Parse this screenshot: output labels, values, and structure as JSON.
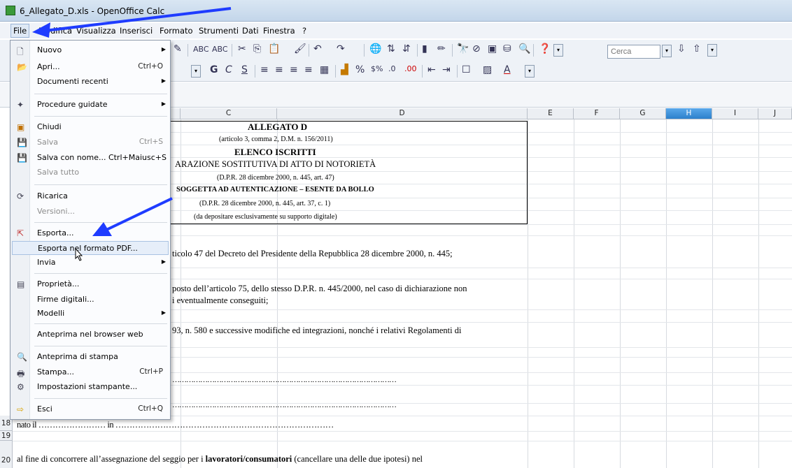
{
  "window": {
    "title": "6_Allegato_D.xls - OpenOffice Calc"
  },
  "menubar": [
    "File",
    "Modifica",
    "Visualizza",
    "Inserisci",
    "Formato",
    "Strumenti",
    "Dati",
    "Finestra",
    "?"
  ],
  "toolbar": {
    "find_placeholder": "Cerca"
  },
  "columns": [
    "C",
    "D",
    "E",
    "F",
    "G",
    "H",
    "I",
    "J"
  ],
  "rows": [
    "18",
    "19",
    "20"
  ],
  "document": {
    "l1": "ALLEGATO D",
    "l2": "(articolo 3, comma 2, D.M. n. 156/2011)",
    "l3": "ELENCO ISCRITTI",
    "l4": "ARAZIONE SOSTITUTIVA DI ATTO DI NOTORIETÀ",
    "l5": "(D.P.R. 28 dicembre 2000, n. 445, art. 47)",
    "l6": "SOGGETTA AD AUTENTICAZIONE – ESENTE DA BOLLO",
    "l7": "(D.P.R. 28 dicembre 2000, n. 445, art. 37, c. 1)",
    "l8": "(da depositare esclusivamente su supporto digitale)",
    "p1": "ticolo 47 del Decreto del Presidente della Repubblica 28 dicembre 2000, n. 445;",
    "p2a": "posto dell’articolo 75, dello stesso D.P.R. n. 445/2000, nel caso di dichiarazione non",
    "p2b": "i eventualmente conseguiti;",
    "p3a": "93, n. 580 e successive modifiche ed integrazioni, nonché i relativi Regolamenti di",
    "dots1": "……………………………………………………………………………………",
    "dots2": "……………………………………………………………………………………",
    "r18": "nato il …………………… in ……………………………………………………………………",
    "r20a": "al fine di concorrere all’assegnazione del seggio per i ",
    "r20b": "lavoratori/consumatori",
    "r20c": " (cancellare una delle due ipotesi) nel"
  },
  "file_menu": [
    {
      "label": "Nuovo",
      "shortcut": "",
      "arrow": true,
      "icon": "new-doc-icon",
      "disabled": false
    },
    {
      "label": "Apri...",
      "shortcut": "Ctrl+O",
      "arrow": false,
      "icon": "open-folder-icon",
      "disabled": false
    },
    {
      "label": "Documenti recenti",
      "shortcut": "",
      "arrow": true,
      "icon": "",
      "disabled": false
    },
    {
      "label": "Procedure guidate",
      "shortcut": "",
      "arrow": true,
      "icon": "wizard-icon",
      "disabled": false
    },
    {
      "label": "Chiudi",
      "shortcut": "",
      "arrow": false,
      "icon": "close-doc-icon",
      "disabled": false
    },
    {
      "label": "Salva",
      "shortcut": "Ctrl+S",
      "arrow": false,
      "icon": "save-icon",
      "disabled": true
    },
    {
      "label": "Salva con nome... Ctrl+Maiusc+S",
      "shortcut": "",
      "arrow": false,
      "icon": "save-as-icon",
      "disabled": false
    },
    {
      "label": "Salva tutto",
      "shortcut": "",
      "arrow": false,
      "icon": "",
      "disabled": true
    },
    {
      "label": "Ricarica",
      "shortcut": "",
      "arrow": false,
      "icon": "reload-icon",
      "disabled": false
    },
    {
      "label": "Versioni...",
      "shortcut": "",
      "arrow": false,
      "icon": "",
      "disabled": true
    },
    {
      "label": "Esporta...",
      "shortcut": "",
      "arrow": false,
      "icon": "export-icon",
      "disabled": false
    },
    {
      "label": "Esporta nel formato PDF...",
      "shortcut": "",
      "arrow": false,
      "icon": "",
      "disabled": false
    },
    {
      "label": "Invia",
      "shortcut": "",
      "arrow": true,
      "icon": "",
      "disabled": false
    },
    {
      "label": "Proprietà...",
      "shortcut": "",
      "arrow": false,
      "icon": "properties-icon",
      "disabled": false
    },
    {
      "label": "Firme digitali...",
      "shortcut": "",
      "arrow": false,
      "icon": "",
      "disabled": false
    },
    {
      "label": "Modelli",
      "shortcut": "",
      "arrow": true,
      "icon": "",
      "disabled": false
    },
    {
      "label": "Anteprima nel browser web",
      "shortcut": "",
      "arrow": false,
      "icon": "",
      "disabled": false
    },
    {
      "label": "Anteprima di stampa",
      "shortcut": "",
      "arrow": false,
      "icon": "print-preview-icon",
      "disabled": false
    },
    {
      "label": "Stampa...",
      "shortcut": "Ctrl+P",
      "arrow": false,
      "icon": "print-icon",
      "disabled": false
    },
    {
      "label": "Impostazioni stampante...",
      "shortcut": "",
      "arrow": false,
      "icon": "printer-settings-icon",
      "disabled": false
    },
    {
      "label": "Esci",
      "shortcut": "Ctrl+Q",
      "arrow": false,
      "icon": "exit-icon",
      "disabled": false
    }
  ]
}
